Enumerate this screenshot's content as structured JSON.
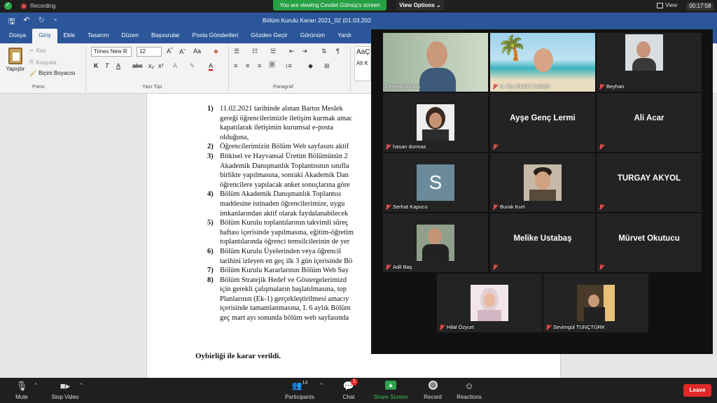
{
  "zoom": {
    "recording_label": "Recording",
    "viewing_banner": "You are viewing Cevdet Gümüş's screen",
    "view_options": "View Options",
    "view_label": "View",
    "timer": "00:17:58",
    "participants_count": "14",
    "chat_badge": "1",
    "bottom": {
      "mute": "Mute",
      "stop_video": "Stop Video",
      "participants": "Participants",
      "chat": "Chat",
      "share_screen": "Share Screen",
      "record": "Record",
      "reactions": "Reactions",
      "leave": "Leave"
    },
    "tiles": [
      {
        "name": "Cevdet Gümüş",
        "muted": false
      },
      {
        "name": "N. İlke EKEN TURER",
        "muted": true
      },
      {
        "name": "Beyhan",
        "muted": true
      },
      {
        "name": "hasan durmaz",
        "muted": true
      },
      {
        "name": "Ayşe Genç Lermi",
        "muted": true
      },
      {
        "name": "Ali Acar",
        "muted": true
      },
      {
        "name": "Serhat Kapucu",
        "muted": true
      },
      {
        "name": "Burak Kurt",
        "muted": true
      },
      {
        "name": "TURGAY AKYOL",
        "muted": true
      },
      {
        "name": "Adil Baş",
        "muted": true
      },
      {
        "name": "Melike Ustabaş",
        "muted": true
      },
      {
        "name": "Mürvet Okutucu",
        "muted": true
      },
      {
        "name": "Hilal Özyurt",
        "muted": true
      },
      {
        "name": "Sevimgül TUNÇTÜRK",
        "muted": true
      }
    ],
    "avatar_letter": "S"
  },
  "word": {
    "title": "Bölüm Kurulu Kararı 2021_02 (01.03.202",
    "tabs": [
      "Dosya",
      "Giriş",
      "Ekle",
      "Tasarım",
      "Düzen",
      "Başvurular",
      "Posta Gönderileri",
      "Gözden Geçir",
      "Görünüm",
      "Yardı"
    ],
    "active_tab": "Giriş",
    "clipboard": {
      "paste": "Yapıştır",
      "cut": "Kes",
      "copy": "Kopyala",
      "format_painter": "Biçim Boyacısı",
      "group": "Pano"
    },
    "font": {
      "name": "Times New R",
      "size": "12",
      "group": "Yazı Tipi"
    },
    "paragraph_group": "Paragraf",
    "styles": {
      "sample": "AaÇ",
      "label": "Alt K"
    },
    "document": {
      "items": [
        {
          "num": "1)",
          "lines": [
            "11.02.2021 tarihinde alınan Bartın Meslek",
            "gereği öğrencilerimizle iletişim kurmak amac",
            "kapatılarak iletişimin kurumsal e-posta",
            "olduğuna,"
          ]
        },
        {
          "num": "2)",
          "lines": [
            "Öğrencilerimizin Bölüm Web sayfasını aktif"
          ]
        },
        {
          "num": "3)",
          "lines": [
            "Bitkisel ve Hayvansal Üretim Bölümünün 2",
            "Akademik Danışmanlık Toplantısının sınıfla",
            "birlikte yapılmasına, sonraki Akademik Dan",
            "öğrencilere yapılacak anket sonuçlarına göre"
          ]
        },
        {
          "num": "4)",
          "lines": [
            "Bölüm Akademik Danışmanlık Toplantısı",
            "maddesine istinaden öğrencilerimize, uygu",
            "imkanlarından aktif olarak faydalanabilecek"
          ]
        },
        {
          "num": "5)",
          "lines": [
            "Bölüm Kurulu toplantılarının takvimli süreç",
            "haftası içerisinde yapılmasına, eğitim-öğretim",
            "toplantılarında öğrenci temsilcilerinin de yer"
          ]
        },
        {
          "num": "6)",
          "lines": [
            "Bölüm Kurulu Üyelerinden veya öğrencil",
            "tarihini izleyen en geç ilk 3 gün içerisinde Bö"
          ]
        },
        {
          "num": "7)",
          "lines": [
            "Bölüm Kurulu Kararlarının Bölüm Web Say"
          ]
        },
        {
          "num": "8)",
          "lines": [
            "Bölüm Stratejik Hedef ve Göstergelerimizd",
            "için gerekli çalışmaların başlatılmasına, top",
            "Planlarının (Ek-1) gerçekleştirilmesi amacıy",
            "içerisinde tamamlanmasına, I. 6 aylık Bölüm",
            "geç mart ayı sonunda bölüm web sayfasında"
          ]
        }
      ],
      "verdict": "Oybirliği ile karar verildi."
    }
  }
}
